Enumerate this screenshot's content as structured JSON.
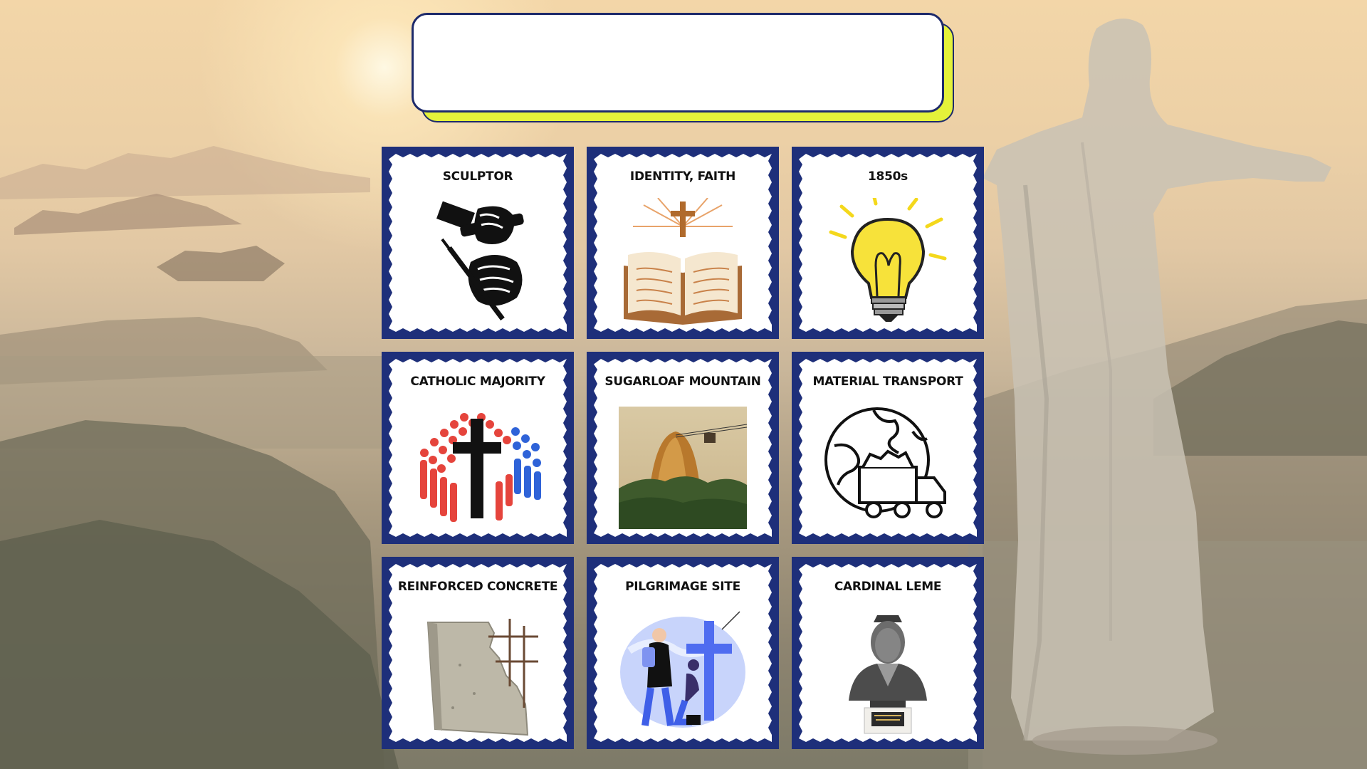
{
  "title_box": {
    "text": ""
  },
  "cards": [
    {
      "label": "SCULPTOR",
      "icon": "chisel-hammer-icon"
    },
    {
      "label": "IDENTITY, FAITH",
      "icon": "bible-cross-icon"
    },
    {
      "label": "1850s",
      "icon": "lightbulb-icon"
    },
    {
      "label": "CATHOLIC MAJORITY",
      "icon": "crowd-cross-icon"
    },
    {
      "label": "SUGARLOAF MOUNTAIN",
      "icon": "sugarloaf-photo"
    },
    {
      "label": "MATERIAL TRANSPORT",
      "icon": "globe-truck-icon"
    },
    {
      "label": "REINFORCED CONCRETE",
      "icon": "concrete-wall-photo"
    },
    {
      "label": "PILGRIMAGE SITE",
      "icon": "pilgrims-icon"
    },
    {
      "label": "CARDINAL LEME",
      "icon": "bust-statue-photo"
    }
  ],
  "colors": {
    "card_border": "#1e2f7a",
    "title_shadow": "#e4f23a",
    "title_border": "#1d2a6b"
  }
}
